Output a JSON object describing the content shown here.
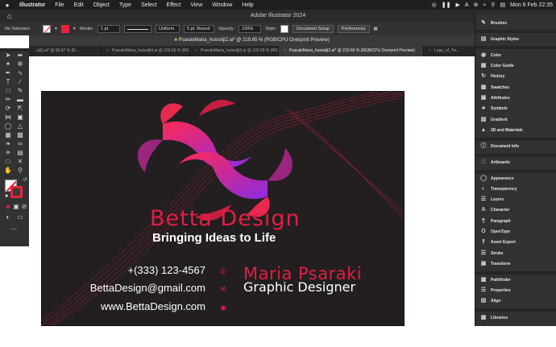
{
  "menubar": {
    "apple": "",
    "app": "Illustrator",
    "items": [
      "File",
      "Edit",
      "Object",
      "Type",
      "Select",
      "Effect",
      "View",
      "Window",
      "Help"
    ],
    "clock": "Mon 6 Feb  22:35",
    "status_a": "A"
  },
  "titlebar": {
    "title": "Adobe Illustrator 2024"
  },
  "control": {
    "selection": "No Selection",
    "stroke_label": "Stroke:",
    "stroke_weight": "1 pt",
    "profile": "Uniform",
    "brush": "5 pt. Round",
    "opacity_label": "Opacity:",
    "opacity": "100%",
    "style_label": "Style:",
    "doc_setup": "Document Setup",
    "preferences": "Preferences"
  },
  "document": {
    "title": "PsarakiMaria_huisstijl2.ai* @ 219.65 % (RGB/CPU Overprint Preview)"
  },
  "tabs": [
    {
      "label": "...tijl1.ai* @ 66.67 % (R..."
    },
    {
      "label": "PsarakiMaria_huisstijl4.ai @ 166.56 % (RG..."
    },
    {
      "label": "PsarakiMaria_huisstijl3.ai @ 102.96 % (RG..."
    },
    {
      "label": "PsarakiMaria_huisstijl2.ai* @ 219.65 % (RGB/CPU Overprint Preview)"
    },
    {
      "label": "Logo_of_Tw..."
    }
  ],
  "card": {
    "brand": "Betta Design",
    "tagline": "Bringing Ideas to Life",
    "phone": "+(333) 123-4567",
    "email": "BettaDesign@gmail.com",
    "website": "www.BettaDesign.com",
    "name": "Maria Psaraki",
    "role": "Graphic Designer",
    "accent": "#e31e45"
  },
  "panels": [
    {
      "label": "Brushes",
      "icon": "brush-icon"
    },
    {
      "label": "Graphic Styles",
      "icon": "graphic-styles-icon"
    },
    {
      "label": "Color",
      "icon": "color-icon"
    },
    {
      "label": "Color Guide",
      "icon": "color-guide-icon"
    },
    {
      "label": "History",
      "icon": "history-icon"
    },
    {
      "label": "Swatches",
      "icon": "swatches-icon"
    },
    {
      "label": "Attributes",
      "icon": "attributes-icon"
    },
    {
      "label": "Symbols",
      "icon": "symbols-icon"
    },
    {
      "label": "Gradient",
      "icon": "gradient-icon"
    },
    {
      "label": "3D and Materials",
      "icon": "3d-icon"
    },
    {
      "label": "Document Info",
      "icon": "document-info-icon"
    },
    {
      "label": "Artboards",
      "icon": "artboards-icon"
    },
    {
      "label": "Appearance",
      "icon": "appearance-icon"
    },
    {
      "label": "Transparency",
      "icon": "transparency-icon"
    },
    {
      "label": "Layers",
      "icon": "layers-icon"
    },
    {
      "label": "Character",
      "icon": "character-icon"
    },
    {
      "label": "Paragraph",
      "icon": "paragraph-icon"
    },
    {
      "label": "OpenType",
      "icon": "opentype-icon"
    },
    {
      "label": "Asset Export",
      "icon": "asset-export-icon"
    },
    {
      "label": "Stroke",
      "icon": "stroke-icon"
    },
    {
      "label": "Transform",
      "icon": "transform-icon"
    },
    {
      "label": "Pathfinder",
      "icon": "pathfinder-icon"
    },
    {
      "label": "Properties",
      "icon": "properties-icon"
    },
    {
      "label": "Align",
      "icon": "align-icon"
    },
    {
      "label": "Libraries",
      "icon": "libraries-icon"
    }
  ]
}
